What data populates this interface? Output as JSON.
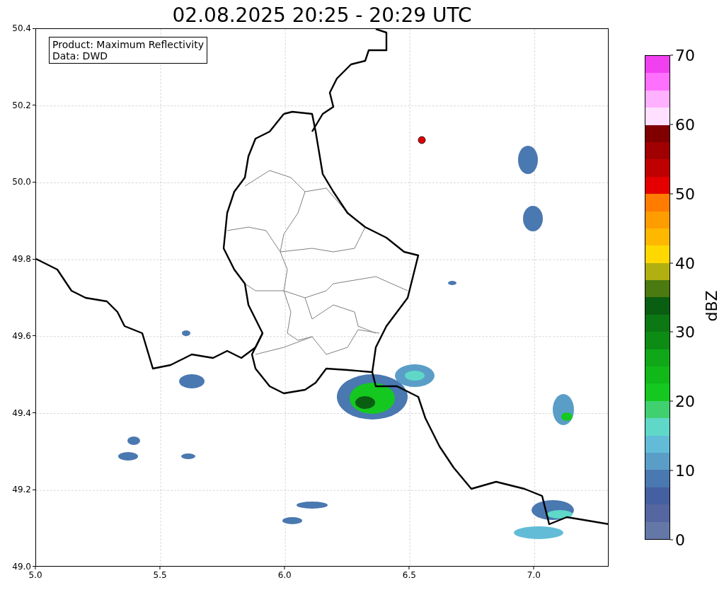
{
  "title": "02.08.2025 20:25 - 20:29 UTC",
  "info_box": {
    "lines": [
      "Product: Maximum Reflectivity",
      "Data: DWD"
    ]
  },
  "y_ticks": [
    "50.4",
    "50.2",
    "50.0",
    "49.8",
    "49.6",
    "49.4",
    "49.2",
    "49.0"
  ],
  "x_ticks": [
    "5.0",
    "5.5",
    "6.0",
    "6.5",
    "7.0"
  ],
  "colorbar": {
    "label": "dBZ",
    "ticks": [
      "70",
      "60",
      "50",
      "40",
      "30",
      "20",
      "10",
      "0"
    ],
    "segments": [
      {
        "color": "#f040f0"
      },
      {
        "color": "#ff70ff"
      },
      {
        "color": "#ffb0ff"
      },
      {
        "color": "#ffe0ff"
      },
      {
        "color": "#800000"
      },
      {
        "color": "#a00000"
      },
      {
        "color": "#c00000"
      },
      {
        "color": "#e40000"
      },
      {
        "color": "#ff7c00"
      },
      {
        "color": "#ff9c00"
      },
      {
        "color": "#ffb800"
      },
      {
        "color": "#ffd800"
      },
      {
        "color": "#b0b010"
      },
      {
        "color": "#4a7a10"
      },
      {
        "color": "#0a5e12"
      },
      {
        "color": "#0c7814"
      },
      {
        "color": "#0c8c14"
      },
      {
        "color": "#10a818"
      },
      {
        "color": "#10b818"
      },
      {
        "color": "#14c820"
      },
      {
        "color": "#40d070"
      },
      {
        "color": "#60d8c8"
      },
      {
        "color": "#62bcd8"
      },
      {
        "color": "#5a9ec8"
      },
      {
        "color": "#4a78b0"
      },
      {
        "color": "#4460a0"
      },
      {
        "color": "#5566a0"
      },
      {
        "color": "#6478a8"
      }
    ]
  }
}
